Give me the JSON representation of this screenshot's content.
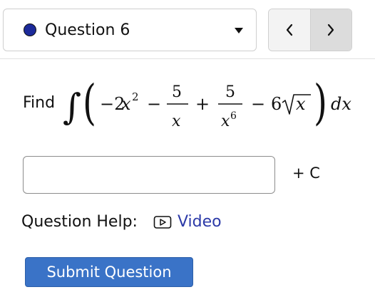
{
  "question_selector": {
    "label": "Question 6",
    "status_color": "#1c2a9a",
    "dropdown_icon": "chevron-down-icon"
  },
  "nav": {
    "prev_icon": "chevron-left-icon",
    "next_icon": "chevron-right-icon"
  },
  "problem": {
    "prompt": "Find",
    "integral": {
      "integral_sign": "∫",
      "left_paren": "(",
      "term1_coef": "−2",
      "term1_var": "x",
      "term1_exp": "2",
      "op1": "−",
      "frac1_num": "5",
      "frac1_den": "x",
      "op2": "+",
      "frac2_num": "5",
      "frac2_den_var": "x",
      "frac2_den_exp": "6",
      "op3": "−",
      "term4_coef": "6",
      "term4_radicand": "x",
      "right_paren": ")",
      "differential": "dx"
    }
  },
  "answer": {
    "value": "",
    "placeholder": "",
    "constant_label": "+ C"
  },
  "help": {
    "label": "Question Help:",
    "video_label": "Video",
    "video_icon": "play-box-icon"
  },
  "submit": {
    "label": "Submit Question",
    "color": "#3a73c7"
  }
}
